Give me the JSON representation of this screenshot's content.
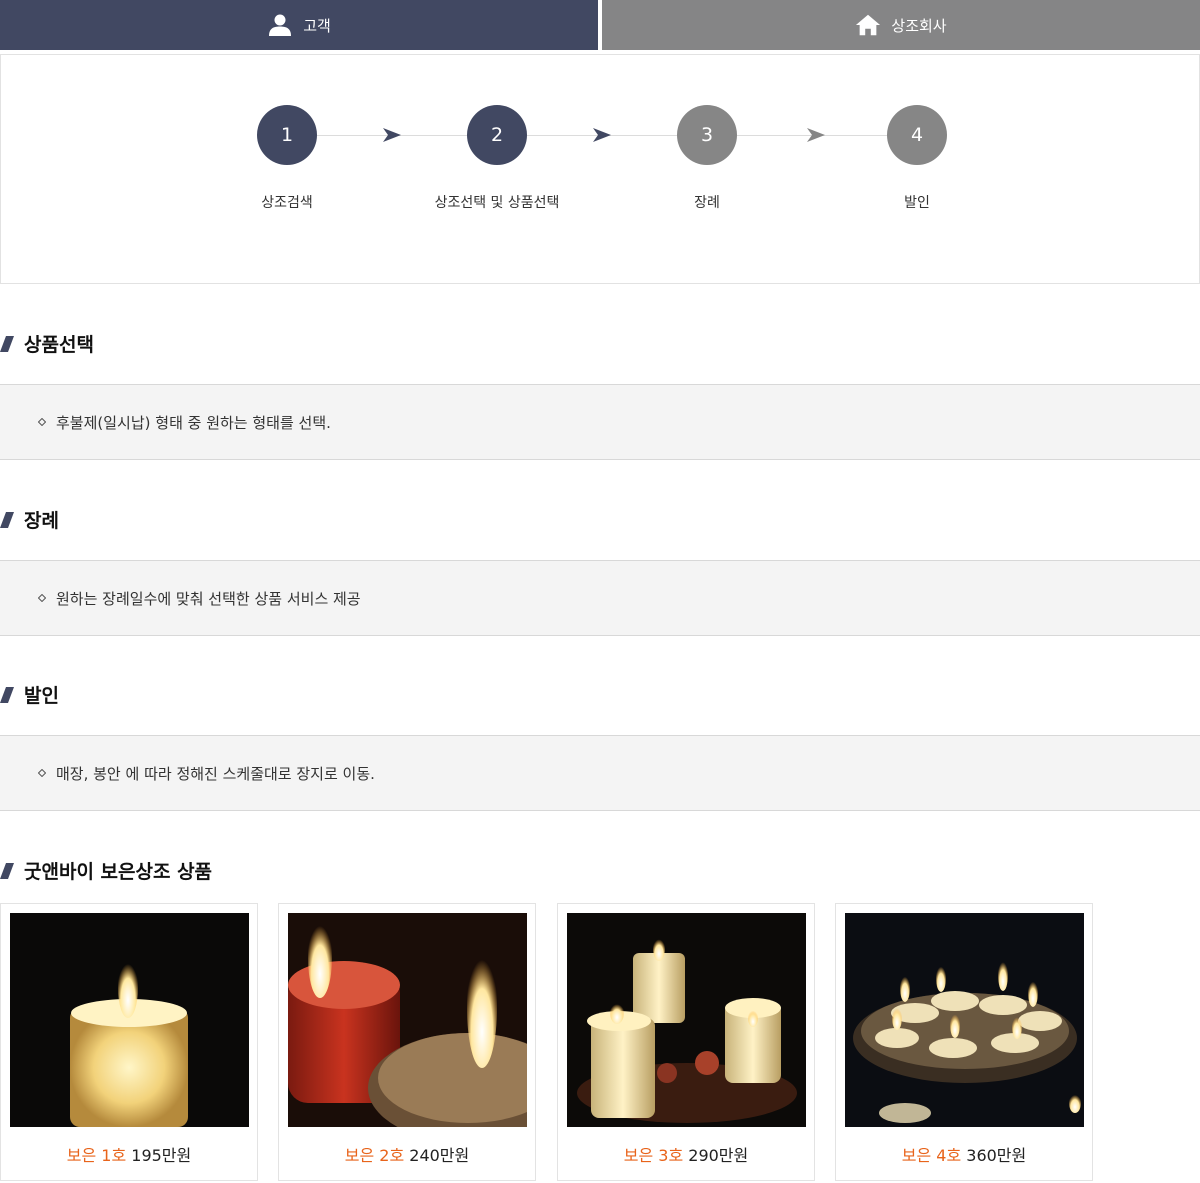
{
  "tabs": {
    "customer": {
      "label": "고객",
      "icon": "person-icon",
      "color": "#414862"
    },
    "company": {
      "label": "상조회사",
      "icon": "home-icon",
      "color": "#858586"
    }
  },
  "steps": [
    {
      "number": "1",
      "label": "상조검색",
      "state": "active"
    },
    {
      "number": "2",
      "label": "상조선택 및 상품선택",
      "state": "active"
    },
    {
      "number": "3",
      "label": "장례",
      "state": "inactive"
    },
    {
      "number": "4",
      "label": "발인",
      "state": "inactive"
    }
  ],
  "sections": [
    {
      "title": "상품선택",
      "description": "후불제(일시납) 형태 중 원하는 형태를 선택."
    },
    {
      "title": "장례",
      "description": "원하는 장례일수에 맞춰 선택한 상품 서비스 제공"
    },
    {
      "title": "발인",
      "description": "매장, 봉안 에 따라 정해진 스케줄대로 장지로 이동."
    }
  ],
  "products": {
    "title": "굿앤바이 보은상조 상품",
    "items": [
      {
        "name": "보은 1호",
        "price": "195만원"
      },
      {
        "name": "보은 2호",
        "price": "240만원"
      },
      {
        "name": "보은 3호",
        "price": "290만원"
      },
      {
        "name": "보은 4호",
        "price": "360만원"
      }
    ]
  },
  "colors": {
    "accent": "#414862",
    "inactive": "#868686",
    "product_name": "#e8641b",
    "info_bg": "#f4f4f4"
  }
}
